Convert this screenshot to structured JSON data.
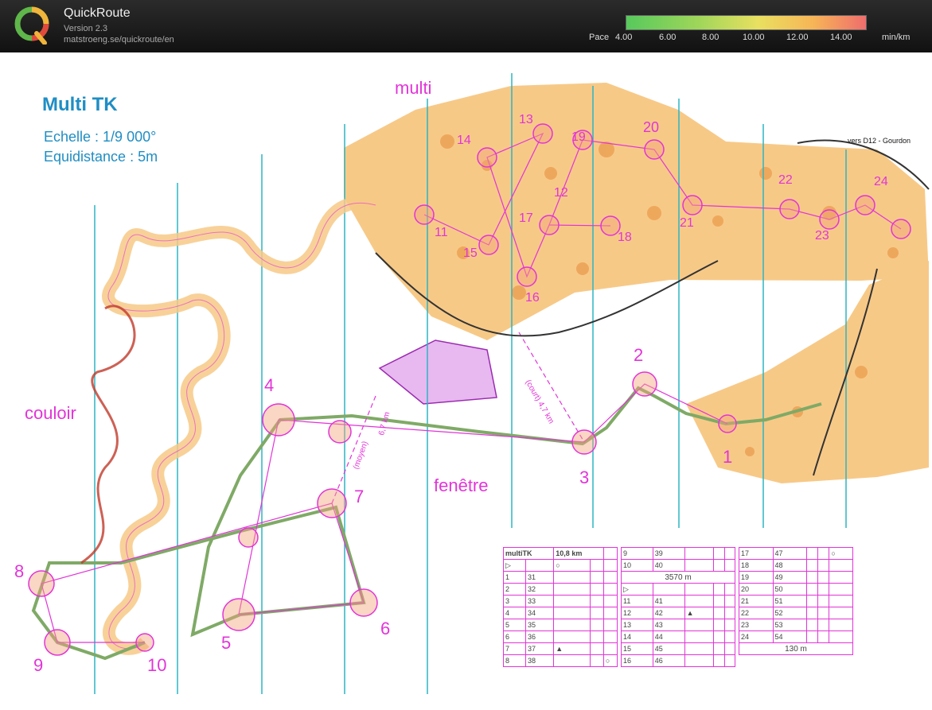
{
  "app": {
    "name": "QuickRoute",
    "version": "Version 2.3",
    "url": "matstroeng.se/quickroute/en"
  },
  "pace_scale": {
    "label": "Pace",
    "ticks": [
      "4.00",
      "6.00",
      "8.00",
      "10.00",
      "12.00",
      "14.00"
    ],
    "unit": "min/km",
    "colors": {
      "slow": "#ef6d6d",
      "mid": "#e9e060",
      "fast": "#57c95c"
    }
  },
  "map": {
    "title": "Multi TK",
    "scale": "Echelle : 1/9 000°",
    "equidistance": "Equidistance : 5m",
    "zones": {
      "multi": "multi",
      "couloir": "couloir",
      "fenetre": "fenêtre"
    },
    "note_road": "vers D12 - Gourdon",
    "leg_labels": {
      "court": "(court) 4,7 km",
      "moyen": "(moyen)",
      "moyen_km": "6,7 km"
    },
    "controls": [
      "1",
      "2",
      "3",
      "4",
      "5",
      "6",
      "7",
      "8",
      "9",
      "10",
      "11",
      "12",
      "13",
      "14",
      "15",
      "16",
      "17",
      "18",
      "19",
      "20",
      "21",
      "22",
      "23",
      "24"
    ],
    "colors": {
      "course": "#e234d8",
      "grid": "#2bb5c4",
      "terrain": "#f7c987",
      "route_green": "#7faa66",
      "route_red": "#c0392b"
    }
  },
  "legend": {
    "course_name": "multiTK",
    "course_length": "10,8 km",
    "col1": [
      [
        "1",
        "31"
      ],
      [
        "2",
        "32"
      ],
      [
        "3",
        "33"
      ],
      [
        "4",
        "34"
      ],
      [
        "5",
        "35"
      ],
      [
        "6",
        "36"
      ],
      [
        "7",
        "37"
      ],
      [
        "8",
        "38"
      ]
    ],
    "col2a": [
      [
        "9",
        "39"
      ],
      [
        "10",
        "40"
      ]
    ],
    "col2_dist": "3570 m",
    "col2b": [
      [
        "11",
        "41"
      ],
      [
        "12",
        "42"
      ],
      [
        "13",
        "43"
      ],
      [
        "14",
        "44"
      ],
      [
        "15",
        "45"
      ],
      [
        "16",
        "46"
      ]
    ],
    "col3": [
      [
        "17",
        "47"
      ],
      [
        "18",
        "48"
      ],
      [
        "19",
        "49"
      ],
      [
        "20",
        "50"
      ],
      [
        "21",
        "51"
      ],
      [
        "22",
        "52"
      ],
      [
        "23",
        "53"
      ],
      [
        "24",
        "54"
      ]
    ],
    "col3_dist": "130 m"
  }
}
